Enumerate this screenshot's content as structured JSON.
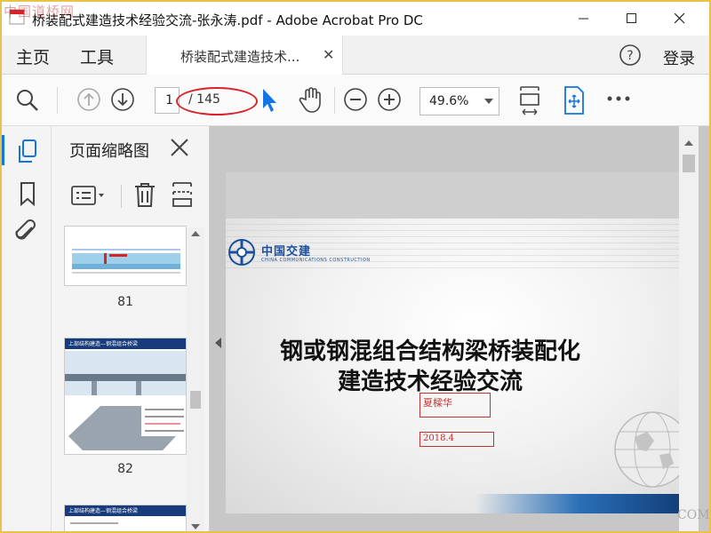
{
  "window": {
    "title": "桥装配式建造技术经验交流-张永涛.pdf - Adobe Acrobat Pro DC",
    "watermark": "中国道桥网"
  },
  "menu": {
    "home": "主页",
    "tools": "工具",
    "doc_tab": "桥装配式建造技术...",
    "login": "登录"
  },
  "toolbar": {
    "current_page": "1",
    "total_pages": "/ 145",
    "zoom": "49.6%"
  },
  "thumbnails": {
    "panel_title": "页面缩略图",
    "items": [
      {
        "page": "81"
      },
      {
        "page": "82",
        "heading": "上部结构建造—钢混组合桥梁"
      },
      {
        "heading": "上部结构建造—钢混组合桥梁"
      }
    ]
  },
  "slide": {
    "logo_text": "中国交建",
    "logo_sub": "CHINA COMMUNICATIONS CONSTRUCTION",
    "title_line1": "钢或钢混组合结构梁桥装配化",
    "title_line2": "建造技术经验交流",
    "author": "夏樑华",
    "date": "2018.4"
  },
  "corner_mark": "COM",
  "colors": {
    "accent": "#1473e6",
    "annotation": "#d8232a",
    "frame": "#e8c34a"
  }
}
